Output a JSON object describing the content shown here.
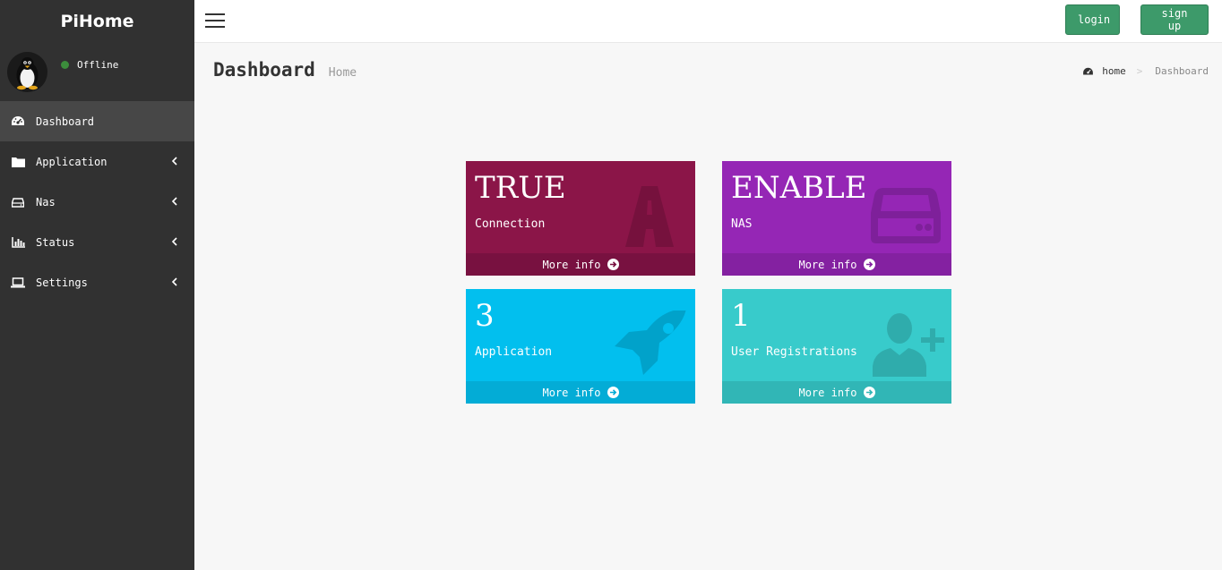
{
  "app": {
    "title": "PiHome"
  },
  "user": {
    "status": "Offline",
    "status_color": "#3c8d3c"
  },
  "sidebar": {
    "items": [
      {
        "label": "Dashboard",
        "icon": "dashboard-icon",
        "active": true
      },
      {
        "label": "Application",
        "icon": "folder-icon"
      },
      {
        "label": "Nas",
        "icon": "hdd-icon"
      },
      {
        "label": "Status",
        "icon": "bar-chart-icon"
      },
      {
        "label": "Settings",
        "icon": "laptop-icon"
      }
    ]
  },
  "topbar": {
    "login_label": "login",
    "signup_label": "sign up",
    "button_color": "#3d9a6a"
  },
  "header": {
    "title": "Dashboard",
    "subtitle": "Home"
  },
  "breadcrumb": {
    "home": "home",
    "current": "Dashboard"
  },
  "boxes": [
    {
      "value": "TRUE",
      "label": "Connection",
      "footer": "More info",
      "color": "#8b1548",
      "icon": "road-icon"
    },
    {
      "value": "ENABLE",
      "label": "NAS",
      "footer": "More info",
      "color": "#9526b5",
      "icon": "hdd-icon"
    },
    {
      "value": "3",
      "label": "Application",
      "footer": "More info",
      "color": "#02bfee",
      "icon": "rocket-icon"
    },
    {
      "value": "1",
      "label": "User Registrations",
      "footer": "More info",
      "color": "#38cbcb",
      "icon": "user-plus-icon"
    }
  ]
}
